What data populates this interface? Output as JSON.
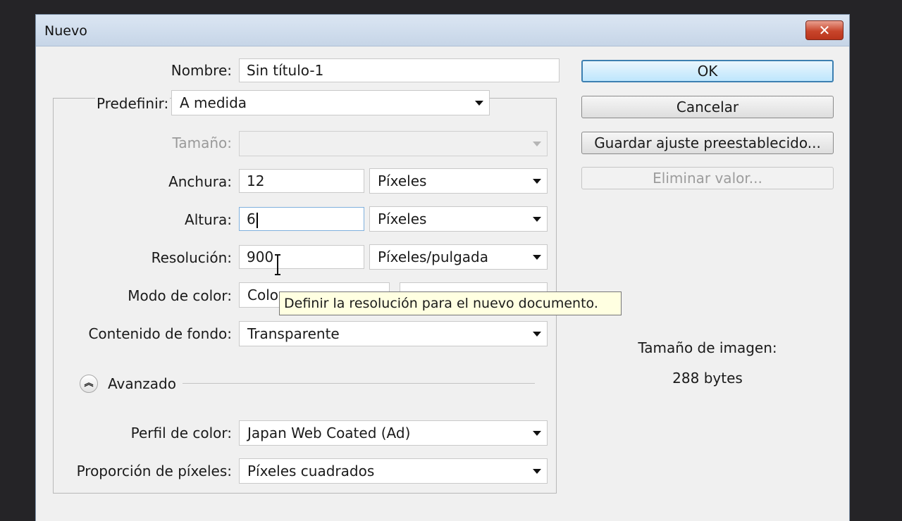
{
  "window": {
    "title": "Nuevo",
    "close_symbol": "✕"
  },
  "form": {
    "nombre": {
      "label": "Nombre:",
      "value": "Sin título-1"
    },
    "predefinir": {
      "label": "Predefinir:",
      "value": "A medida"
    },
    "tamano": {
      "label": "Tamaño:",
      "value": ""
    },
    "anchura": {
      "label": "Anchura:",
      "value": "12",
      "unit": "Píxeles"
    },
    "altura": {
      "label": "Altura:",
      "value": "6",
      "unit": "Píxeles"
    },
    "resolucion": {
      "label": "Resolución:",
      "value": "900",
      "unit": "Píxeles/pulgada"
    },
    "modo_color": {
      "label": "Modo de color:",
      "value_visible": "Colo",
      "bits_visible": ""
    },
    "contenido_fondo": {
      "label": "Contenido de fondo:",
      "value": "Transparente"
    },
    "avanzado": {
      "label": "Avanzado"
    },
    "perfil_color": {
      "label": "Perfil de color:",
      "value": "Japan Web Coated (Ad)"
    },
    "proporcion_pixeles": {
      "label": "Proporción de píxeles:",
      "value": "Píxeles cuadrados"
    }
  },
  "buttons": {
    "ok": "OK",
    "cancelar": "Cancelar",
    "guardar": "Guardar ajuste preestablecido...",
    "eliminar": "Eliminar valor..."
  },
  "image_size": {
    "label": "Tamaño de imagen:",
    "value": "288 bytes"
  },
  "tooltip": "Definir la resolución para el nuevo documento.",
  "icons": {
    "close": "close-icon",
    "dropdown": "chevron-down-icon",
    "advanced": "double-chevron-up-icon"
  }
}
